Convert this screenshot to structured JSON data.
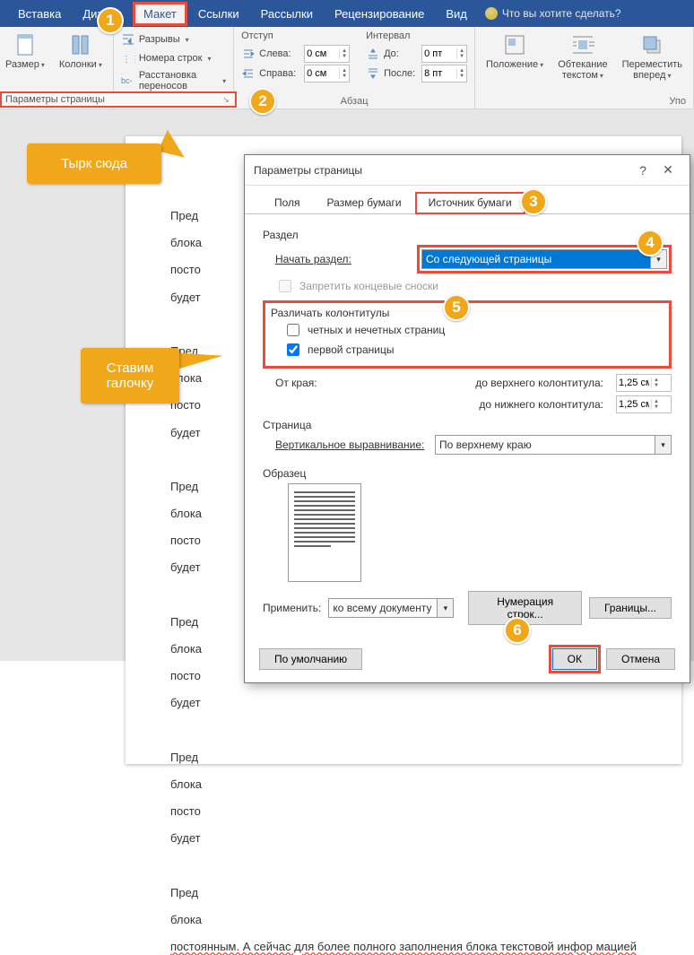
{
  "ribbon": {
    "tabs": [
      "Вставка",
      "Дизайн",
      "Макет",
      "Ссылки",
      "Рассылки",
      "Рецензирование",
      "Вид"
    ],
    "tell_me": "Что вы хотите сделать?",
    "group1": {
      "size": "Размер",
      "columns": "Колонки"
    },
    "group2": {
      "breaks": "Разрывы",
      "linenum": "Номера строк",
      "hyphen": "Расстановка переносов",
      "launcher_label": "Параметры страницы"
    },
    "indent": {
      "title": "Отступ",
      "left": "Слева:",
      "right": "Справа:",
      "left_val": "0 см",
      "right_val": "0 см"
    },
    "interval": {
      "title": "Интервал",
      "before": "До:",
      "after": "После:",
      "before_val": "0 пт",
      "after_val": "8 пт"
    },
    "paragraph_label": "Абзац",
    "arrange": {
      "position": "Положение",
      "wrap": "Обтекание текстом",
      "forward": "Переместить вперед",
      "label": "Упо"
    }
  },
  "doc": {
    "p1": "Пред",
    "p2": "блока",
    "p3": "посто",
    "p4": "будет",
    "last": "постоянным. А сейчас для более полного заполнения блока текстовой инфор мацией"
  },
  "dialog": {
    "title": "Параметры страницы",
    "tabs": {
      "fields": "Поля",
      "paper": "Размер бумаги",
      "source": "Источник бумаги"
    },
    "section": "Раздел",
    "start_section": "Начать раздел:",
    "start_section_val": "Со следующей страницы",
    "suppress_endnotes": "Запретить концевые сноски",
    "hf_title": "Различать колонтитулы",
    "odd_even": "четных и нечетных страниц",
    "first_page": "первой страницы",
    "from_edge": "От края:",
    "header_dist": "до верхнего колонтитула:",
    "footer_dist": "до нижнего колонтитула:",
    "dist_val": "1,25 см",
    "page_sec": "Страница",
    "valign": "Вертикальное выравнивание:",
    "valign_val": "По верхнему краю",
    "sample": "Образец",
    "apply": "Применить:",
    "apply_val": "ко всему документу",
    "line_numbers": "Нумерация строк...",
    "borders": "Границы...",
    "default": "По умолчанию",
    "ok": "ОК",
    "cancel": "Отмена"
  },
  "callouts": {
    "c1": "Тырк сюда",
    "c2": "Ставим галочку"
  },
  "numbers": {
    "n1": "1",
    "n2": "2",
    "n3": "3",
    "n4": "4",
    "n5": "5",
    "n6": "6"
  }
}
